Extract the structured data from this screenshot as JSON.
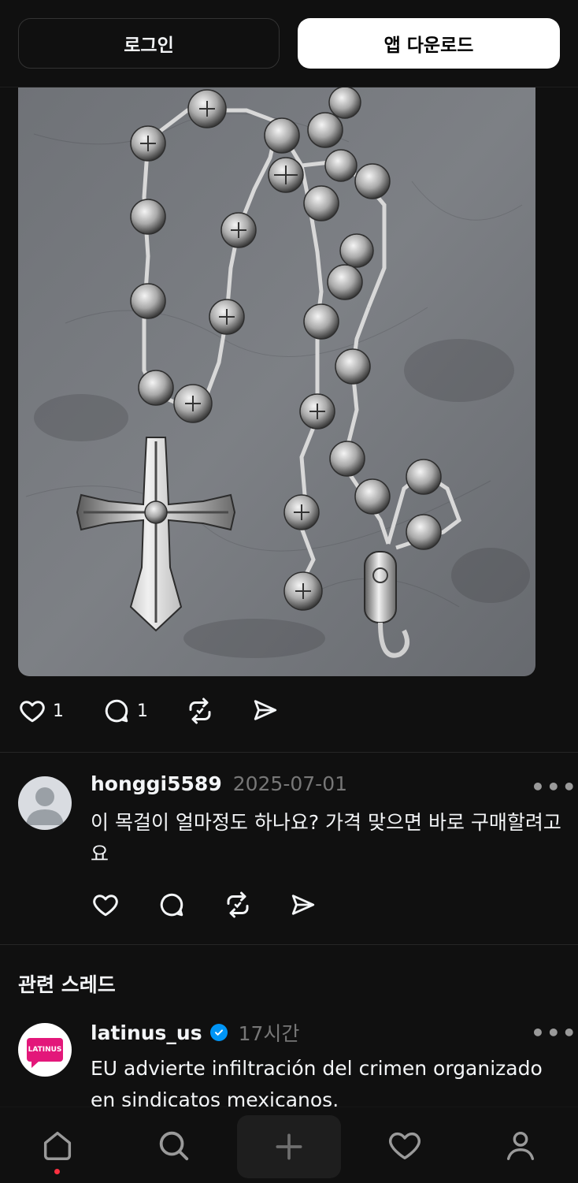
{
  "header": {
    "login_label": "로그인",
    "app_download_label": "앱 다운로드"
  },
  "post": {
    "like_count": "1",
    "comment_count": "1"
  },
  "comment": {
    "username": "honggi5589",
    "date": "2025-07-01",
    "text": "이 목걸이 얼마정도 하나요? 가격 맞으면 바로 구매할려고요"
  },
  "related": {
    "section_title": "관련 스레드",
    "thread": {
      "username": "latinus_us",
      "time": "17시간",
      "avatar_text": "LATINUS",
      "text": "EU advierte infiltración del crimen organizado en sindicatos mexicanos."
    }
  },
  "colors": {
    "background": "#101010",
    "accent_verified": "#0095f6",
    "notification_dot": "#ff3040",
    "latinus_brand": "#e3177a"
  },
  "icons": {
    "like": "heart-icon",
    "comment": "comment-bubble-icon",
    "repost": "repost-icon",
    "share": "send-icon",
    "more": "more-dots-icon",
    "nav": [
      "home-icon",
      "search-icon",
      "plus-icon",
      "heart-icon",
      "profile-icon"
    ]
  }
}
